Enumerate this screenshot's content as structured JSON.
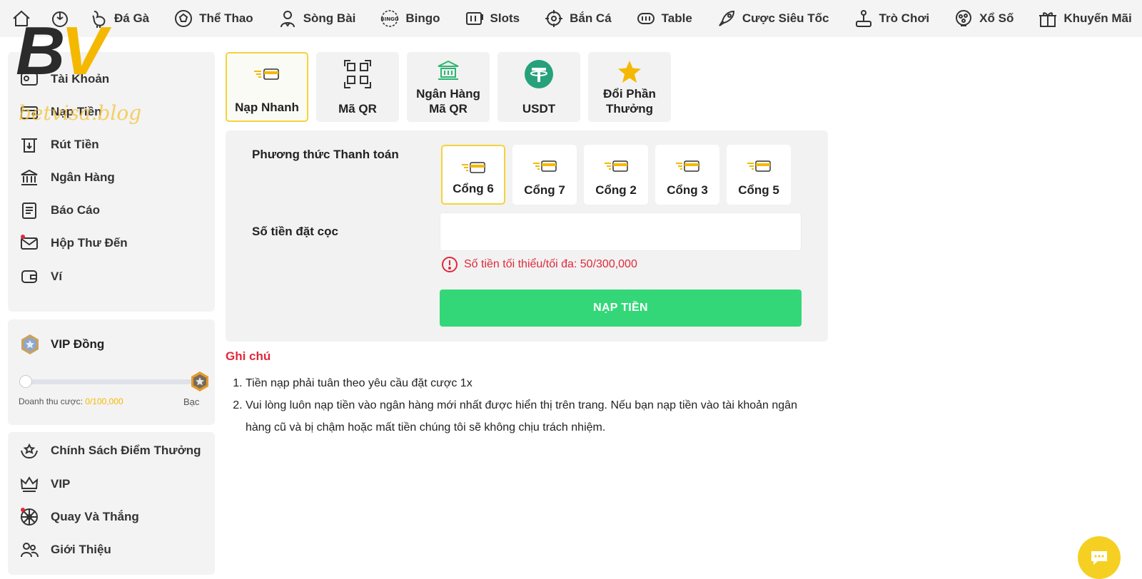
{
  "nav": {
    "items": [
      {
        "label": "Đá Gà",
        "icon": "rooster-icon"
      },
      {
        "label": "Thể Thao",
        "icon": "soccer-ball-icon"
      },
      {
        "label": "Sòng Bài",
        "icon": "dealer-icon"
      },
      {
        "label": "Bingo",
        "icon": "bingo-icon"
      },
      {
        "label": "Slots",
        "icon": "slot-machine-icon"
      },
      {
        "label": "Bắn Cá",
        "icon": "crosshair-icon"
      },
      {
        "label": "Table",
        "icon": "table-game-icon"
      },
      {
        "label": "Cược Siêu Tốc",
        "icon": "rocket-icon"
      },
      {
        "label": "Trò Chơi",
        "icon": "joystick-icon"
      },
      {
        "label": "Xổ Số",
        "icon": "lottery-icon"
      },
      {
        "label": "Khuyến Mãi",
        "icon": "gift-icon"
      }
    ]
  },
  "logo": {
    "b": "B",
    "v": "V",
    "sub": "betvisa.blog"
  },
  "sidebar": {
    "account": [
      {
        "label": "Tài Khoản",
        "icon": "user-card-icon"
      },
      {
        "label": "Nạp Tiền",
        "icon": "wallet-deposit-icon"
      },
      {
        "label": "Rút Tiền",
        "icon": "withdraw-icon"
      },
      {
        "label": "Ngân Hàng",
        "icon": "bank-icon"
      },
      {
        "label": "Báo Cáo",
        "icon": "report-icon"
      },
      {
        "label": "Hộp Thư Đến",
        "icon": "mail-icon"
      },
      {
        "label": "Ví",
        "icon": "wallet-icon"
      }
    ],
    "vip": {
      "title": "VIP Đồng",
      "turnover_label": "Doanh thu cược:",
      "turnover_value": "0/100,000",
      "next_tier": "Bạc",
      "progress": 0
    },
    "more": [
      {
        "label": "Chính Sách Điểm Thưởng",
        "icon": "reward-hands-icon"
      },
      {
        "label": "VIP",
        "icon": "crown-icon"
      },
      {
        "label": "Quay Và Thắng",
        "icon": "wheel-icon"
      },
      {
        "label": "Giới Thiệu",
        "icon": "referral-icon"
      }
    ]
  },
  "tabs": [
    {
      "label": "Nạp Nhanh",
      "icon": "fast-card-icon",
      "active": true
    },
    {
      "label": "Mã QR",
      "icon": "qr-code-icon"
    },
    {
      "label": "Ngân Hàng Mã QR",
      "icon": "bank-qr-icon"
    },
    {
      "label": "USDT",
      "icon": "tether-icon"
    },
    {
      "label": "Đổi Phần Thưởng",
      "icon": "star-icon"
    }
  ],
  "form": {
    "method_label": "Phương thức Thanh toán",
    "gates": [
      "Cổng 6",
      "Cổng 7",
      "Cổng 2",
      "Cổng 3",
      "Cổng 5"
    ],
    "amount_label": "Số tiền đặt cọc",
    "amount_value": "",
    "error": "Số tiền tối thiểu/tối đa: 50/300,000",
    "submit": "NẠP TIỀN"
  },
  "notes": {
    "title": "Ghi chú",
    "items": [
      "Tiền nạp phải tuân theo yêu cầu đặt cược 1x",
      "Vui lòng luôn nạp tiền vào ngân hàng mới nhất được hiển thị trên trang. Nếu bạn nạp tiền vào tài khoản ngân hàng cũ và bị chậm hoặc mất tiền chúng tôi sẽ không chịu trách nhiệm."
    ]
  },
  "colors": {
    "accent": "#f5d33a",
    "submit": "#33d778",
    "error": "#e0293a",
    "chat": "#f5d022"
  }
}
